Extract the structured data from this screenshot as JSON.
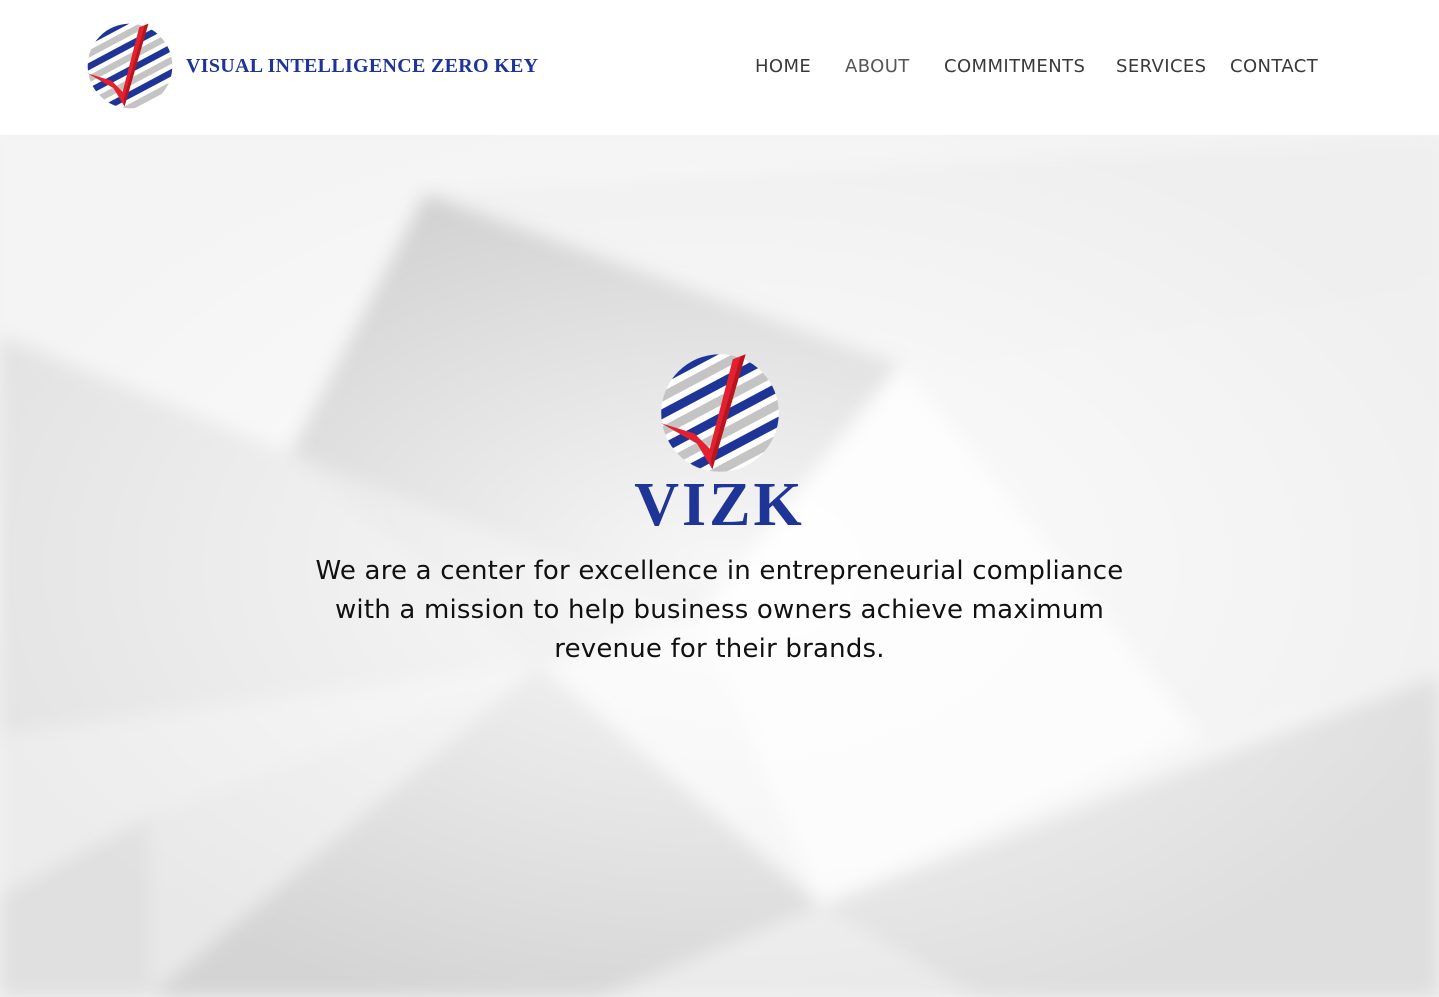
{
  "colors": {
    "brand_blue": "#1f3497",
    "brand_red": "#e5202e",
    "stripe_gray": "#c4c4c4",
    "nav_text": "#3a3a3a"
  },
  "header": {
    "logo_icon": "globe-checkmark-icon",
    "brand_name": "VISUAL INTELLIGENCE ZERO KEY",
    "nav": [
      {
        "label": "HOME"
      },
      {
        "label": "ABOUT"
      },
      {
        "label": "COMMITMENTS"
      },
      {
        "label": "SERVICES"
      },
      {
        "label": "CONTACT"
      }
    ]
  },
  "hero": {
    "emblem_icon": "globe-checkmark-icon",
    "wordmark": "VIZK",
    "tagline": "We are a center for excellence in entrepreneurial compliance with a mission to help business owners achieve maximum revenue for their brands."
  }
}
